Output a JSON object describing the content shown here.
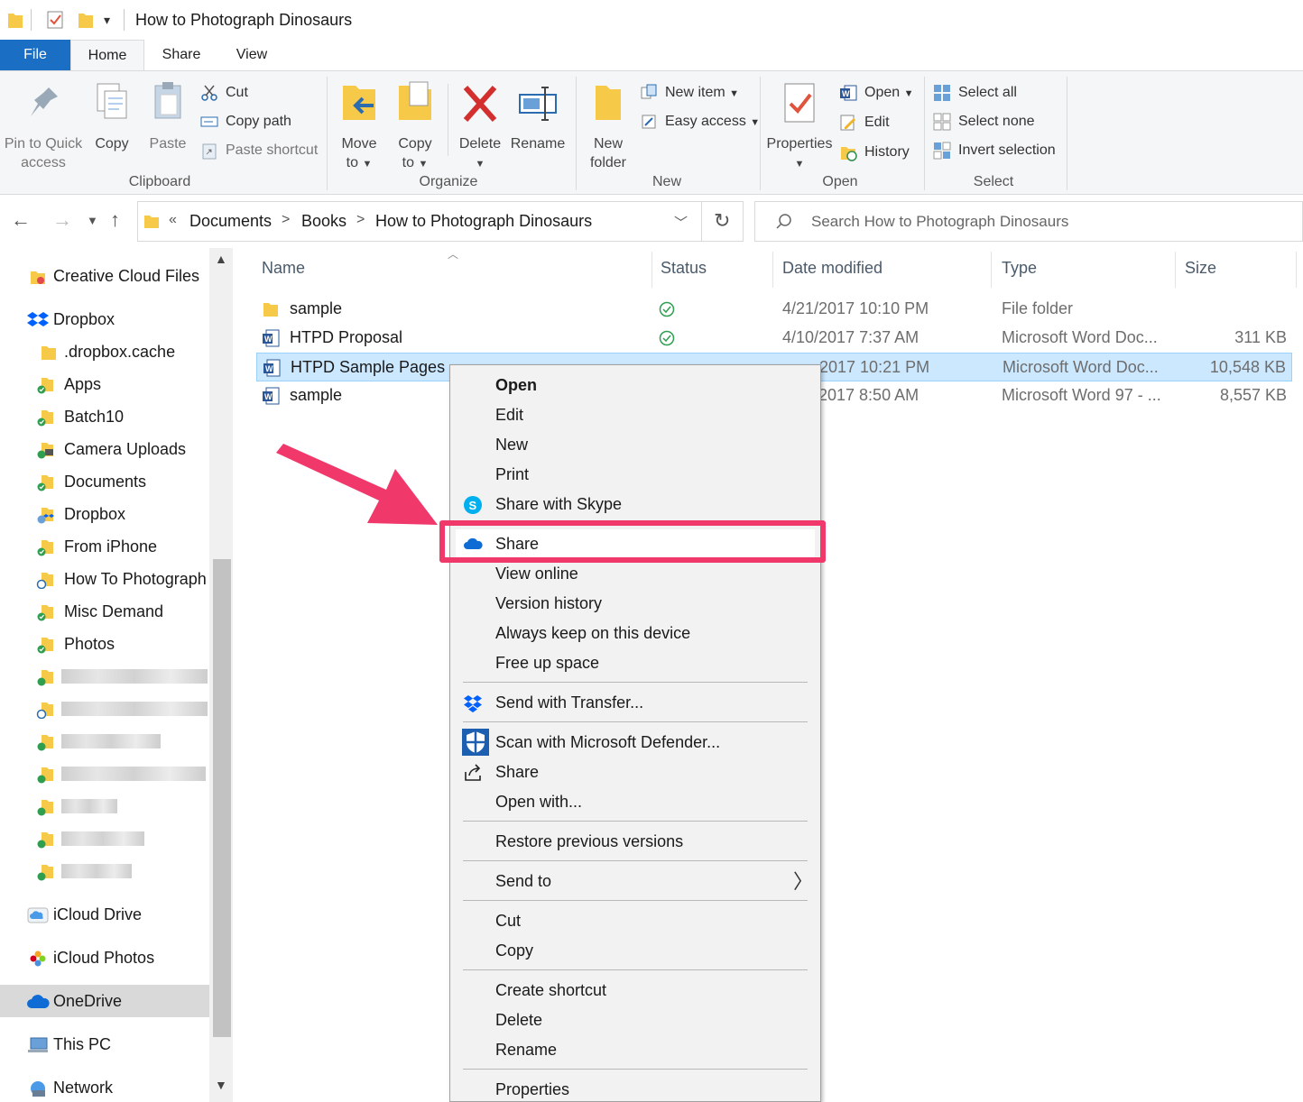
{
  "window": {
    "title": "How to Photograph Dinosaurs"
  },
  "ribbon_tabs": [
    "File",
    "Home",
    "Share",
    "View"
  ],
  "ribbon": {
    "clipboard": {
      "group_label": "Clipboard",
      "pin_label_1": "Pin to Quick",
      "pin_label_2": "access",
      "copy_label": "Copy",
      "paste_label": "Paste",
      "cut_label": "Cut",
      "copy_path_label": "Copy path",
      "paste_shortcut_label": "Paste shortcut"
    },
    "organize": {
      "group_label": "Organize",
      "move_label_1": "Move",
      "move_label_2": "to",
      "copy_label_1": "Copy",
      "copy_label_2": "to",
      "delete_label": "Delete",
      "rename_label": "Rename"
    },
    "new": {
      "group_label": "New",
      "folder_label_1": "New",
      "folder_label_2": "folder",
      "new_item_label": "New item",
      "easy_access_label": "Easy access"
    },
    "open": {
      "group_label": "Open",
      "properties_label": "Properties",
      "open_label": "Open",
      "edit_label": "Edit",
      "history_label": "History"
    },
    "select": {
      "group_label": "Select",
      "select_all_label": "Select all",
      "select_none_label": "Select none",
      "invert_label": "Invert selection"
    }
  },
  "address": {
    "overflow": "«",
    "crumbs": [
      "Documents",
      "Books",
      "How to Photograph Dinosaurs"
    ],
    "separator": ">",
    "search_placeholder": "Search How to Photograph Dinosaurs"
  },
  "navpane": {
    "items": [
      {
        "label": "Creative Cloud Files",
        "icon": "creative-cloud-icon"
      },
      {
        "label": "Dropbox",
        "icon": "dropbox-icon"
      },
      {
        "label": ".dropbox.cache",
        "icon": "folder-icon"
      },
      {
        "label": "Apps",
        "icon": "folder-synced-icon"
      },
      {
        "label": "Batch10",
        "icon": "folder-synced-icon"
      },
      {
        "label": "Camera Uploads",
        "icon": "folder-camera-icon"
      },
      {
        "label": "Documents",
        "icon": "folder-synced-icon"
      },
      {
        "label": "Dropbox",
        "icon": "folder-dropbox-icon"
      },
      {
        "label": "From iPhone",
        "icon": "folder-synced-icon"
      },
      {
        "label": "How To Photograph",
        "icon": "folder-sync-pending-icon"
      },
      {
        "label": "Misc Demand",
        "icon": "folder-synced-icon"
      },
      {
        "label": "Photos",
        "icon": "folder-synced-icon"
      },
      {
        "label": "iCloud Drive",
        "icon": "icloud-icon"
      },
      {
        "label": "iCloud Photos",
        "icon": "icloud-photos-icon"
      },
      {
        "label": "OneDrive",
        "icon": "onedrive-icon"
      },
      {
        "label": "This PC",
        "icon": "this-pc-icon"
      },
      {
        "label": "Network",
        "icon": "network-icon"
      }
    ]
  },
  "filelist": {
    "columns": [
      "Name",
      "Status",
      "Date modified",
      "Type",
      "Size"
    ],
    "rows": [
      {
        "name": "sample",
        "date": "4/21/2017 10:10 PM",
        "type": "File folder",
        "size": ""
      },
      {
        "name": "HTPD Proposal",
        "date": "4/10/2017 7:37 AM",
        "type": "Microsoft Word Doc...",
        "size": "311 KB"
      },
      {
        "name": "HTPD Sample Pages",
        "date": "2017 10:21 PM",
        "type": "Microsoft Word Doc...",
        "size": "10,548 KB"
      },
      {
        "name": "sample",
        "date": "2017 8:50 AM",
        "type": "Microsoft Word 97 - ...",
        "size": "8,557 KB"
      }
    ]
  },
  "context_menu": {
    "items": [
      "Open",
      "Edit",
      "New",
      "Print",
      "Share with Skype",
      "Share",
      "View online",
      "Version history",
      "Always keep on this device",
      "Free up space",
      "Send with Transfer...",
      "Scan with Microsoft Defender...",
      "Share",
      "Open with...",
      "Restore previous versions",
      "Send to",
      "Cut",
      "Copy",
      "Create shortcut",
      "Delete",
      "Rename",
      "Properties"
    ],
    "highlight_color": "#f0386b"
  },
  "colors": {
    "accent": "#1a6fc4",
    "selection": "#cce8ff",
    "annotation": "#f0386b"
  }
}
